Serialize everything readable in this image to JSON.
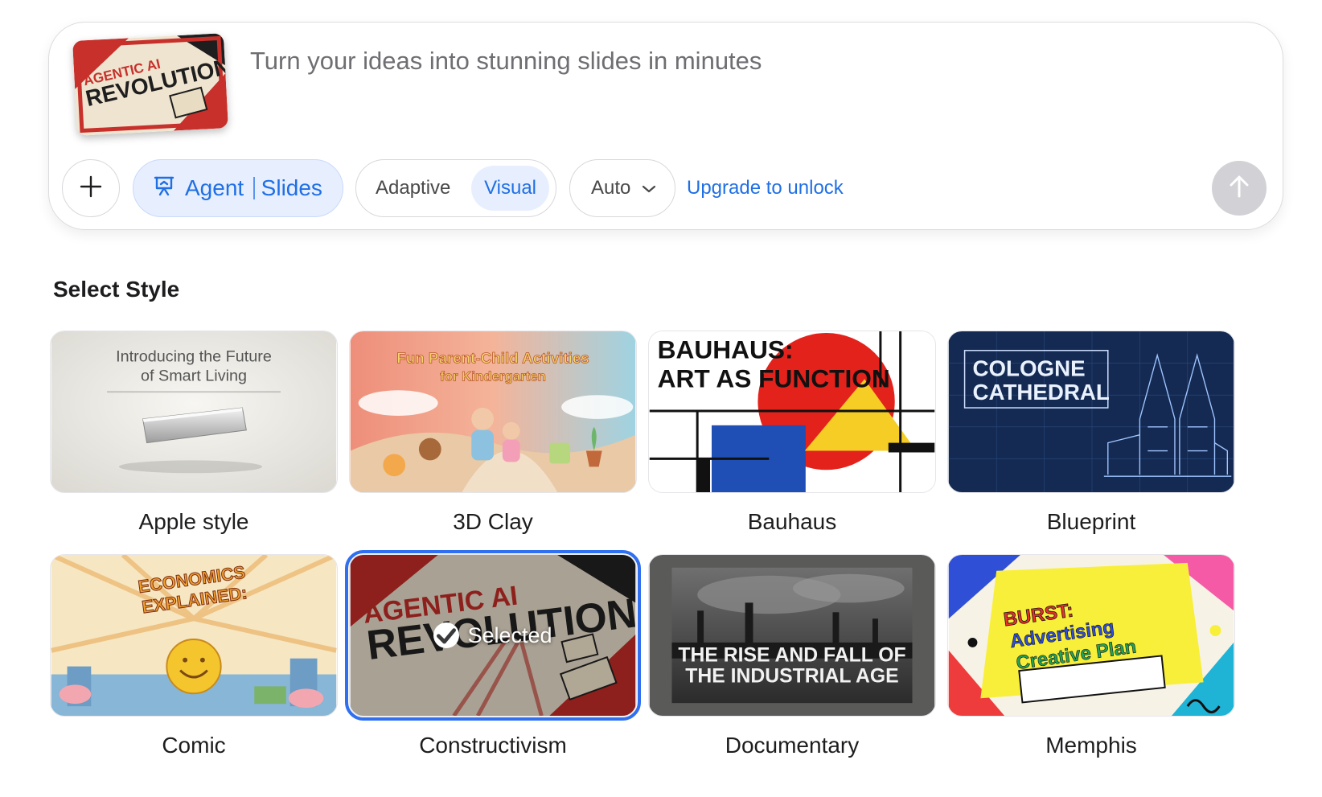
{
  "prompt": {
    "placeholder": "Turn your ideas into stunning slides in minutes",
    "attachment_text": [
      "AGENTIC AI",
      "REVOLUTION"
    ]
  },
  "toolbar": {
    "add_icon": "plus-icon",
    "agent_label": "Agent",
    "slides_label": "Slides",
    "agent_icon": "presentation-icon",
    "mode_options": [
      "Adaptive",
      "Visual"
    ],
    "mode_selected": "Visual",
    "model_select": "Auto",
    "upgrade_label": "Upgrade to unlock",
    "send_icon": "arrow-up-icon"
  },
  "styles": {
    "title": "Select Style",
    "selected_badge": "Selected",
    "items": [
      {
        "label": "Apple style",
        "thumb_text": [
          "Introducing the Future",
          "of Smart Living"
        ]
      },
      {
        "label": "3D Clay",
        "thumb_text": [
          "Fun Parent-Child Activities",
          "for Kindergarten"
        ]
      },
      {
        "label": "Bauhaus",
        "thumb_text": [
          "BAUHAUS:",
          "ART AS FUNCTION"
        ]
      },
      {
        "label": "Blueprint",
        "thumb_text": [
          "COLOGNE",
          "CATHEDRAL"
        ]
      },
      {
        "label": "Comic",
        "thumb_text": [
          "ECONOMICS",
          "EXPLAINED:"
        ]
      },
      {
        "label": "Constructivism",
        "thumb_text": [
          "AGENTIC AI",
          "REVOLUTION"
        ],
        "selected": true
      },
      {
        "label": "Documentary",
        "thumb_text": [
          "THE RISE AND FALL OF",
          "THE INDUSTRIAL AGE"
        ]
      },
      {
        "label": "Memphis",
        "thumb_text": [
          "BURST:",
          "Advertising",
          "Creative Plan"
        ]
      }
    ]
  },
  "colors": {
    "accent": "#1f6fe5",
    "selected_outline": "#2f6ff0"
  }
}
